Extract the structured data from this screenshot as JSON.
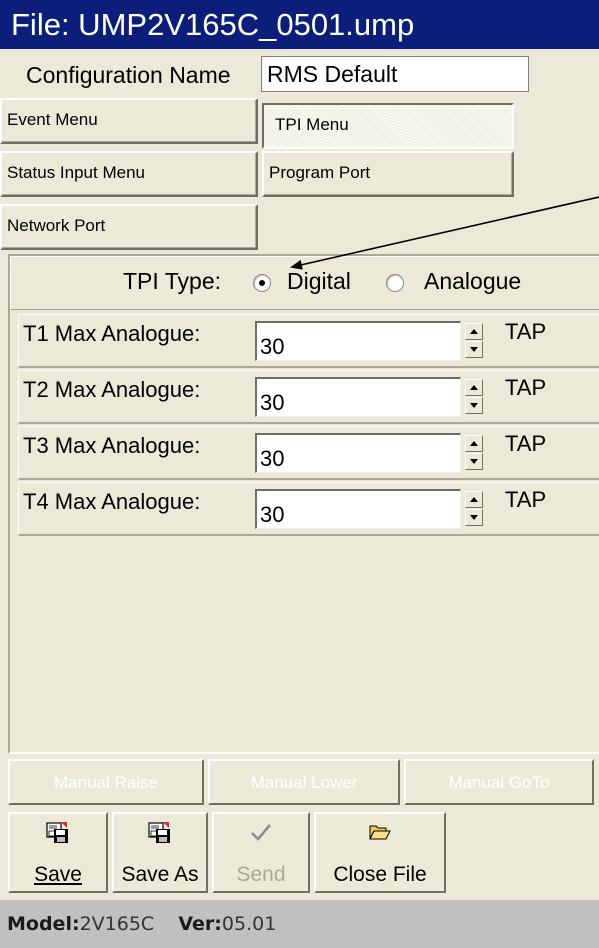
{
  "window": {
    "title": "File: UMP2V165C_0501.ump"
  },
  "config": {
    "label": "Configuration Name",
    "value": "RMS Default"
  },
  "menus": {
    "event": "Event Menu",
    "tpi": "TPI Menu",
    "status_input": "Status Input Menu",
    "program_port": "Program Port",
    "network_port": "Network Port"
  },
  "tpi": {
    "type_label": "TPI Type:",
    "options": [
      {
        "label": "Digital",
        "selected": true
      },
      {
        "label": "Analogue",
        "selected": false
      }
    ],
    "rows": [
      {
        "label": "T1 Max Analogue:",
        "value": "30",
        "unit": "TAP"
      },
      {
        "label": "T2 Max Analogue:",
        "value": "30",
        "unit": "TAP"
      },
      {
        "label": "T3 Max Analogue:",
        "value": "30",
        "unit": "TAP"
      },
      {
        "label": "T4 Max Analogue:",
        "value": "30",
        "unit": "TAP"
      }
    ]
  },
  "manual": {
    "raise": "Manual Raise",
    "lower": "Manual Lower",
    "goto": "Manual GoTo"
  },
  "toolbar": {
    "save": "Save",
    "save_as": "Save As",
    "send": "Send",
    "close": "Close File",
    "icons": {
      "save": "floppy-save-icon",
      "save_as": "floppy-save-as-icon",
      "send": "checkmark-icon",
      "close": "folder-open-icon"
    }
  },
  "status": {
    "model_label": "Model:",
    "model": "2V165C",
    "ver_label": "Ver:",
    "ver": "05.01"
  },
  "colors": {
    "titlebar": "#0a1e7a",
    "face": "#ece9d8",
    "statusbar": "#c0c0c0"
  }
}
